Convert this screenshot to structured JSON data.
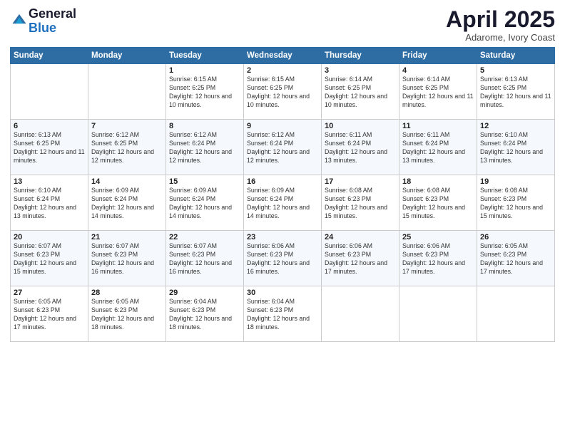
{
  "logo": {
    "general": "General",
    "blue": "Blue"
  },
  "header": {
    "title": "April 2025",
    "subtitle": "Adarome, Ivory Coast"
  },
  "weekdays": [
    "Sunday",
    "Monday",
    "Tuesday",
    "Wednesday",
    "Thursday",
    "Friday",
    "Saturday"
  ],
  "weeks": [
    [
      {
        "day": "",
        "info": ""
      },
      {
        "day": "",
        "info": ""
      },
      {
        "day": "1",
        "info": "Sunrise: 6:15 AM\nSunset: 6:25 PM\nDaylight: 12 hours and 10 minutes."
      },
      {
        "day": "2",
        "info": "Sunrise: 6:15 AM\nSunset: 6:25 PM\nDaylight: 12 hours and 10 minutes."
      },
      {
        "day": "3",
        "info": "Sunrise: 6:14 AM\nSunset: 6:25 PM\nDaylight: 12 hours and 10 minutes."
      },
      {
        "day": "4",
        "info": "Sunrise: 6:14 AM\nSunset: 6:25 PM\nDaylight: 12 hours and 11 minutes."
      },
      {
        "day": "5",
        "info": "Sunrise: 6:13 AM\nSunset: 6:25 PM\nDaylight: 12 hours and 11 minutes."
      }
    ],
    [
      {
        "day": "6",
        "info": "Sunrise: 6:13 AM\nSunset: 6:25 PM\nDaylight: 12 hours and 11 minutes."
      },
      {
        "day": "7",
        "info": "Sunrise: 6:12 AM\nSunset: 6:25 PM\nDaylight: 12 hours and 12 minutes."
      },
      {
        "day": "8",
        "info": "Sunrise: 6:12 AM\nSunset: 6:24 PM\nDaylight: 12 hours and 12 minutes."
      },
      {
        "day": "9",
        "info": "Sunrise: 6:12 AM\nSunset: 6:24 PM\nDaylight: 12 hours and 12 minutes."
      },
      {
        "day": "10",
        "info": "Sunrise: 6:11 AM\nSunset: 6:24 PM\nDaylight: 12 hours and 13 minutes."
      },
      {
        "day": "11",
        "info": "Sunrise: 6:11 AM\nSunset: 6:24 PM\nDaylight: 12 hours and 13 minutes."
      },
      {
        "day": "12",
        "info": "Sunrise: 6:10 AM\nSunset: 6:24 PM\nDaylight: 12 hours and 13 minutes."
      }
    ],
    [
      {
        "day": "13",
        "info": "Sunrise: 6:10 AM\nSunset: 6:24 PM\nDaylight: 12 hours and 13 minutes."
      },
      {
        "day": "14",
        "info": "Sunrise: 6:09 AM\nSunset: 6:24 PM\nDaylight: 12 hours and 14 minutes."
      },
      {
        "day": "15",
        "info": "Sunrise: 6:09 AM\nSunset: 6:24 PM\nDaylight: 12 hours and 14 minutes."
      },
      {
        "day": "16",
        "info": "Sunrise: 6:09 AM\nSunset: 6:24 PM\nDaylight: 12 hours and 14 minutes."
      },
      {
        "day": "17",
        "info": "Sunrise: 6:08 AM\nSunset: 6:23 PM\nDaylight: 12 hours and 15 minutes."
      },
      {
        "day": "18",
        "info": "Sunrise: 6:08 AM\nSunset: 6:23 PM\nDaylight: 12 hours and 15 minutes."
      },
      {
        "day": "19",
        "info": "Sunrise: 6:08 AM\nSunset: 6:23 PM\nDaylight: 12 hours and 15 minutes."
      }
    ],
    [
      {
        "day": "20",
        "info": "Sunrise: 6:07 AM\nSunset: 6:23 PM\nDaylight: 12 hours and 15 minutes."
      },
      {
        "day": "21",
        "info": "Sunrise: 6:07 AM\nSunset: 6:23 PM\nDaylight: 12 hours and 16 minutes."
      },
      {
        "day": "22",
        "info": "Sunrise: 6:07 AM\nSunset: 6:23 PM\nDaylight: 12 hours and 16 minutes."
      },
      {
        "day": "23",
        "info": "Sunrise: 6:06 AM\nSunset: 6:23 PM\nDaylight: 12 hours and 16 minutes."
      },
      {
        "day": "24",
        "info": "Sunrise: 6:06 AM\nSunset: 6:23 PM\nDaylight: 12 hours and 17 minutes."
      },
      {
        "day": "25",
        "info": "Sunrise: 6:06 AM\nSunset: 6:23 PM\nDaylight: 12 hours and 17 minutes."
      },
      {
        "day": "26",
        "info": "Sunrise: 6:05 AM\nSunset: 6:23 PM\nDaylight: 12 hours and 17 minutes."
      }
    ],
    [
      {
        "day": "27",
        "info": "Sunrise: 6:05 AM\nSunset: 6:23 PM\nDaylight: 12 hours and 17 minutes."
      },
      {
        "day": "28",
        "info": "Sunrise: 6:05 AM\nSunset: 6:23 PM\nDaylight: 12 hours and 18 minutes."
      },
      {
        "day": "29",
        "info": "Sunrise: 6:04 AM\nSunset: 6:23 PM\nDaylight: 12 hours and 18 minutes."
      },
      {
        "day": "30",
        "info": "Sunrise: 6:04 AM\nSunset: 6:23 PM\nDaylight: 12 hours and 18 minutes."
      },
      {
        "day": "",
        "info": ""
      },
      {
        "day": "",
        "info": ""
      },
      {
        "day": "",
        "info": ""
      }
    ]
  ]
}
